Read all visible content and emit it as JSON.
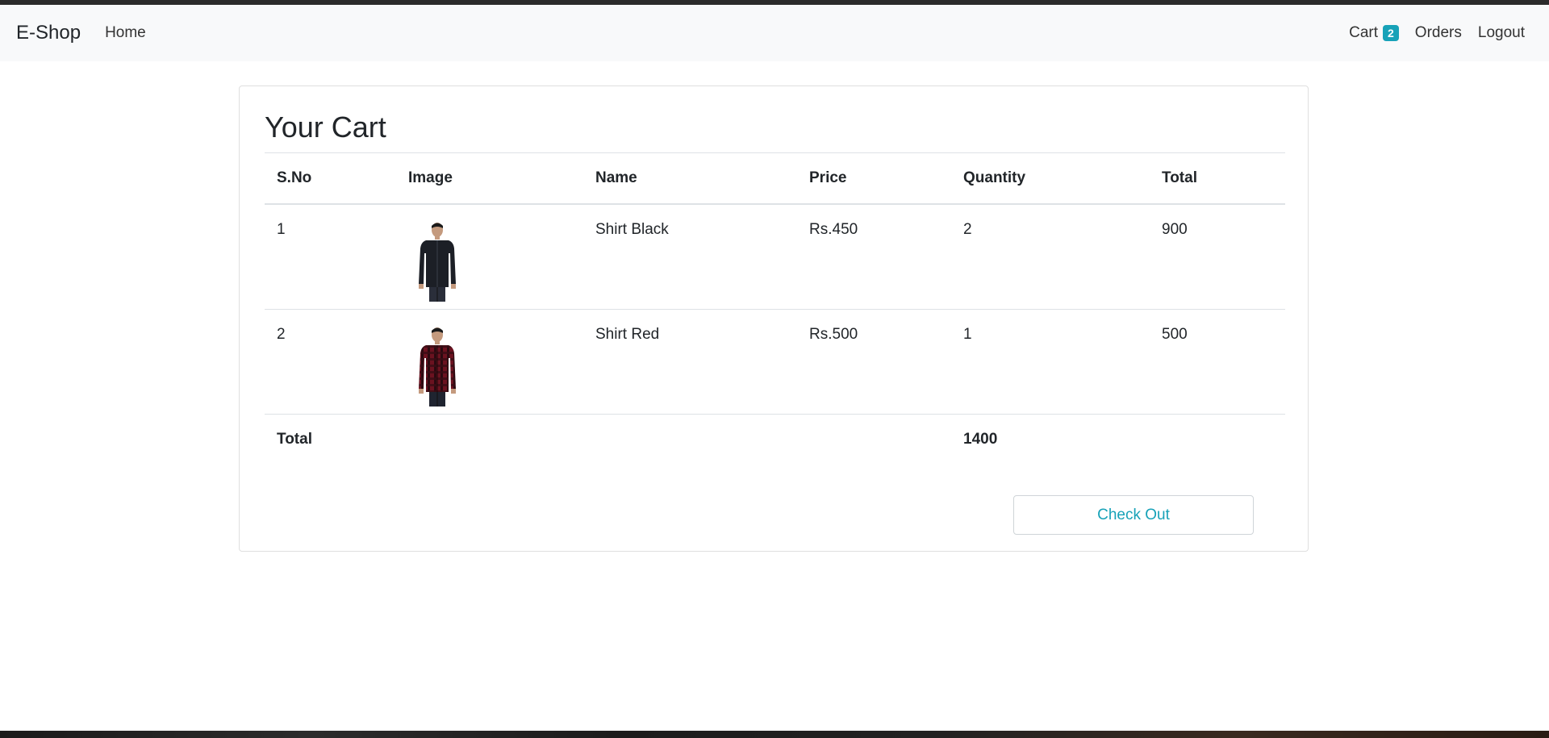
{
  "navbar": {
    "brand": "E-Shop",
    "home": "Home",
    "cart": "Cart",
    "cart_count": "2",
    "orders": "Orders",
    "logout": "Logout"
  },
  "cart": {
    "title": "Your Cart",
    "columns": [
      "S.No",
      "Image",
      "Name",
      "Price",
      "Quantity",
      "Total"
    ],
    "items": [
      {
        "sno": "1",
        "image": "shirt-black",
        "name": "Shirt Black",
        "price": "Rs.450",
        "quantity": "2",
        "total": "900"
      },
      {
        "sno": "2",
        "image": "shirt-red",
        "name": "Shirt Red",
        "price": "Rs.500",
        "quantity": "1",
        "total": "500"
      }
    ],
    "total_label": "Total",
    "total_value": "1400",
    "checkout_label": "Check Out"
  },
  "colors": {
    "accent": "#17a2b8",
    "navbar_bg": "#f8f9fa"
  }
}
